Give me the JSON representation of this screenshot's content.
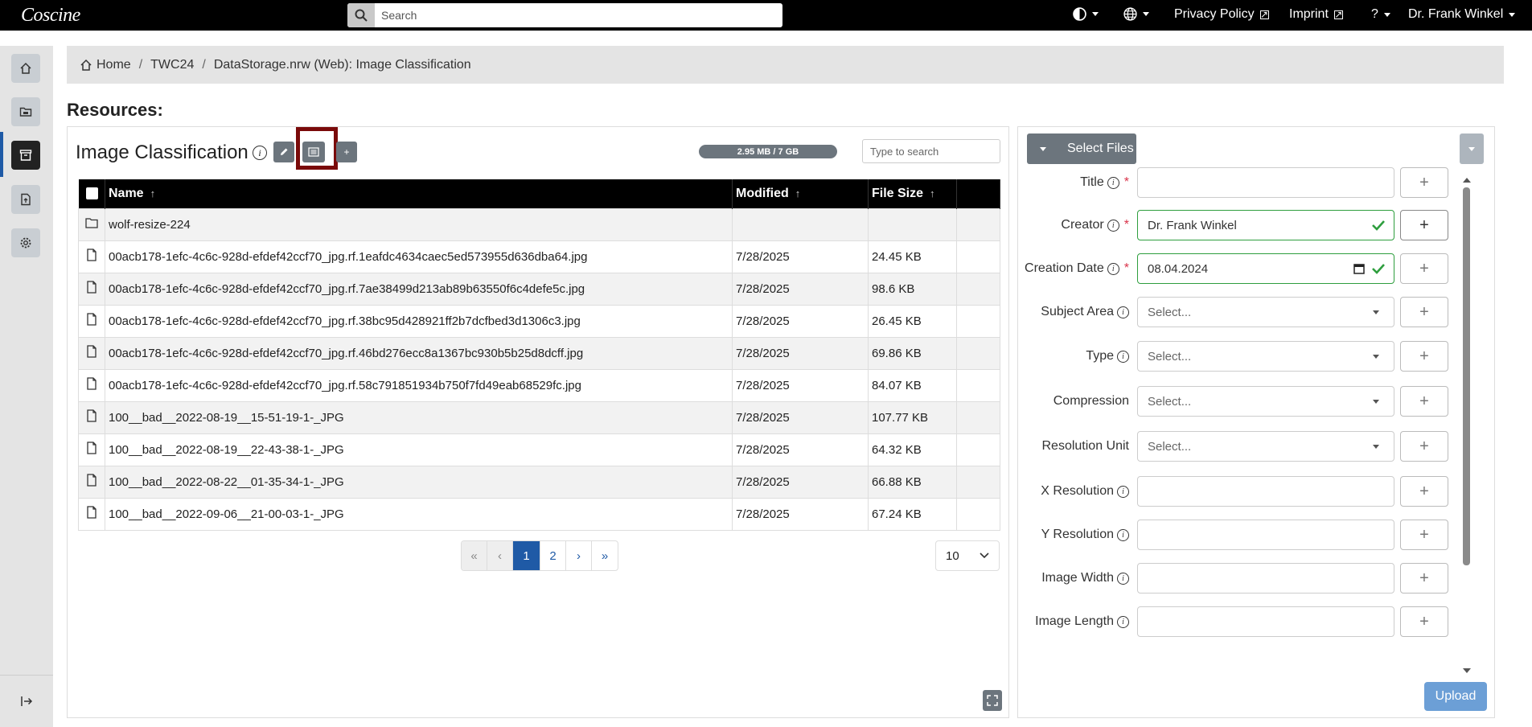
{
  "app": {
    "logo_text": "Coscine",
    "search_placeholder": "Search",
    "nav": {
      "privacy": "Privacy Policy",
      "imprint": "Imprint",
      "help": "?",
      "user": "Dr. Frank Winkel"
    }
  },
  "breadcrumb": {
    "home": "Home",
    "project": "TWC24",
    "resource": "DataStorage.nrw (Web): Image Classification"
  },
  "page_title": "Resources:",
  "resource": {
    "title": "Image Classification",
    "storage": "2.95 MB / 7 GB",
    "table_search_placeholder": "Type to search",
    "columns": {
      "name": "Name",
      "modified": "Modified",
      "size": "File Size"
    },
    "rows": [
      {
        "type": "folder",
        "name": "wolf-resize-224",
        "modified": "",
        "size": ""
      },
      {
        "type": "file",
        "name": "00acb178-1efc-4c6c-928d-efdef42ccf70_jpg.rf.1eafdc4634caec5ed573955d636dba64.jpg",
        "modified": "7/28/2025",
        "size": "24.45 KB"
      },
      {
        "type": "file",
        "name": "00acb178-1efc-4c6c-928d-efdef42ccf70_jpg.rf.7ae38499d213ab89b63550f6c4defe5c.jpg",
        "modified": "7/28/2025",
        "size": "98.6 KB"
      },
      {
        "type": "file",
        "name": "00acb178-1efc-4c6c-928d-efdef42ccf70_jpg.rf.38bc95d428921ff2b7dcfbed3d1306c3.jpg",
        "modified": "7/28/2025",
        "size": "26.45 KB"
      },
      {
        "type": "file",
        "name": "00acb178-1efc-4c6c-928d-efdef42ccf70_jpg.rf.46bd276ecc8a1367bc930b5b25d8dcff.jpg",
        "modified": "7/28/2025",
        "size": "69.86 KB"
      },
      {
        "type": "file",
        "name": "00acb178-1efc-4c6c-928d-efdef42ccf70_jpg.rf.58c791851934b750f7fd49eab68529fc.jpg",
        "modified": "7/28/2025",
        "size": "84.07 KB"
      },
      {
        "type": "file",
        "name": "100__bad__2022-08-19__15-51-19-1-_JPG",
        "modified": "7/28/2025",
        "size": "107.77 KB"
      },
      {
        "type": "file",
        "name": "100__bad__2022-08-19__22-43-38-1-_JPG",
        "modified": "7/28/2025",
        "size": "64.32 KB"
      },
      {
        "type": "file",
        "name": "100__bad__2022-08-22__01-35-34-1-_JPG",
        "modified": "7/28/2025",
        "size": "66.88 KB"
      },
      {
        "type": "file",
        "name": "100__bad__2022-09-06__21-00-03-1-_JPG",
        "modified": "7/28/2025",
        "size": "67.24 KB"
      }
    ],
    "pagination": {
      "first": "«",
      "prev": "‹",
      "pages": [
        "1",
        "2"
      ],
      "current": "1",
      "next": "›",
      "last": "»"
    },
    "per_page": "10"
  },
  "metadata": {
    "select_files_label": "Select Files",
    "upload_label": "Upload",
    "fields": [
      {
        "key": "title",
        "label": "Title",
        "info": true,
        "required": true,
        "value": "",
        "placeholder": "",
        "kind": "text"
      },
      {
        "key": "creator",
        "label": "Creator",
        "info": true,
        "required": true,
        "value": "Dr. Frank Winkel",
        "placeholder": "",
        "kind": "text",
        "valid": true
      },
      {
        "key": "creation_date",
        "label": "Creation Date",
        "info": true,
        "required": true,
        "value": "08.04.2024",
        "placeholder": "",
        "kind": "date",
        "valid": true
      },
      {
        "key": "subject_area",
        "label": "Subject Area",
        "info": true,
        "required": false,
        "value": "",
        "placeholder": "Select...",
        "kind": "select"
      },
      {
        "key": "type",
        "label": "Type",
        "info": true,
        "required": false,
        "value": "",
        "placeholder": "Select...",
        "kind": "select"
      },
      {
        "key": "compression",
        "label": "Compression",
        "info": false,
        "required": false,
        "value": "",
        "placeholder": "Select...",
        "kind": "select"
      },
      {
        "key": "resolution_unit",
        "label": "Resolution Unit",
        "info": false,
        "required": false,
        "value": "",
        "placeholder": "Select...",
        "kind": "select"
      },
      {
        "key": "x_resolution",
        "label": "X Resolution",
        "info": true,
        "required": false,
        "value": "",
        "placeholder": "",
        "kind": "text"
      },
      {
        "key": "y_resolution",
        "label": "Y Resolution",
        "info": true,
        "required": false,
        "value": "",
        "placeholder": "",
        "kind": "text"
      },
      {
        "key": "image_width",
        "label": "Image Width",
        "info": true,
        "required": false,
        "value": "",
        "placeholder": "",
        "kind": "text"
      },
      {
        "key": "image_length",
        "label": "Image Length",
        "info": true,
        "required": false,
        "value": "",
        "placeholder": "",
        "kind": "text"
      }
    ],
    "colors": {
      "valid": "#2e9e3e",
      "required": "#d9334a",
      "primary": "#1f5aa6"
    }
  }
}
